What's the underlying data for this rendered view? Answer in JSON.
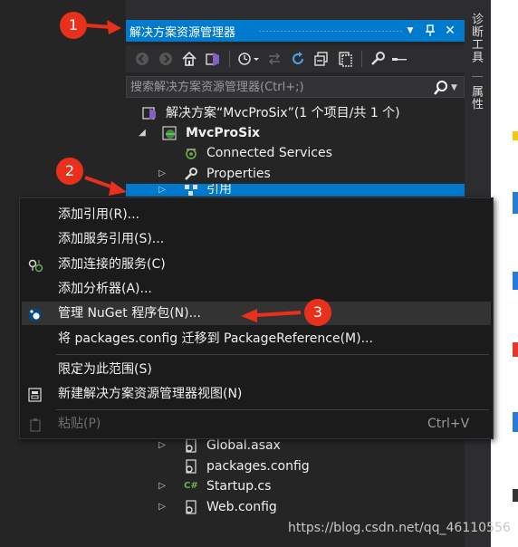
{
  "panel": {
    "title": "解决方案资源管理器",
    "search_placeholder": "搜索解决方案资源管理器(Ctrl+;)"
  },
  "tree": {
    "solution": "解决方案“MvcProSix”(1 个项目/共 1 个)",
    "project": "MvcProSix",
    "items": [
      {
        "label": "Connected Services"
      },
      {
        "label": "Properties"
      },
      {
        "label": "引用"
      }
    ],
    "lower_items": [
      {
        "label": "Global.asax"
      },
      {
        "label": "packages.config"
      },
      {
        "label": "Startup.cs"
      },
      {
        "label": "Web.config"
      }
    ]
  },
  "vtabs": {
    "diagnostics": "诊断工具",
    "properties": "属性"
  },
  "context_menu": {
    "items": [
      {
        "label": "添加引用(R)..."
      },
      {
        "label": "添加服务引用(S)..."
      },
      {
        "label": "添加连接的服务(C)"
      },
      {
        "label": "添加分析器(A)..."
      },
      {
        "label": "管理 NuGet 程序包(N)..."
      },
      {
        "label": "将 packages.config 迁移到 PackageReference(M)..."
      },
      {
        "label": "限定为此范围(S)"
      },
      {
        "label": "新建解决方案资源管理器视图(N)"
      },
      {
        "label": "粘贴(P)",
        "shortcut": "Ctrl+V"
      }
    ]
  },
  "annotations": {
    "step1": "1",
    "step2": "2",
    "step3": "3",
    "color": "#e8301c"
  },
  "watermark": "https://blog.csdn.net/qq_46110556",
  "colors": {
    "accent": "#007acc",
    "background": "#252526",
    "menu_bg": "#1b1b1c"
  }
}
